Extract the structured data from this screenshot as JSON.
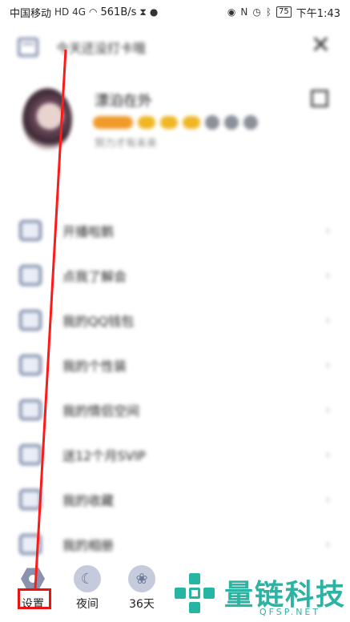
{
  "status_bar": {
    "carrier": "中国移动",
    "signal_label": "HD 4G",
    "speed": "561B/s",
    "battery": "75",
    "time": "下午1:43"
  },
  "checkin": {
    "text": "今天还没打卡哦"
  },
  "profile": {
    "nickname": "漂泊在外",
    "signature": "努力才有未来"
  },
  "menu": {
    "items": [
      {
        "label": "开播啦鹅",
        "icon": "live-icon"
      },
      {
        "label": "点我了解会",
        "icon": "vip-crown-icon"
      },
      {
        "label": "我的QQ钱包",
        "icon": "wallet-icon"
      },
      {
        "label": "我的个性装",
        "icon": "shirt-icon"
      },
      {
        "label": "我的情侣空间",
        "icon": "couple-icon"
      },
      {
        "label": "送12个月SVIP",
        "icon": "gift-icon"
      },
      {
        "label": "我的收藏",
        "icon": "bookmark-icon"
      },
      {
        "label": "我的相册",
        "icon": "album-icon"
      }
    ]
  },
  "bottom": {
    "settings": "设置",
    "night": "夜间",
    "weather": "36天"
  },
  "watermark": {
    "title": "量链科技",
    "sub": "QFSP.NET"
  },
  "colors": {
    "highlight": "#e11111",
    "watermark": "#2bb3a4"
  }
}
